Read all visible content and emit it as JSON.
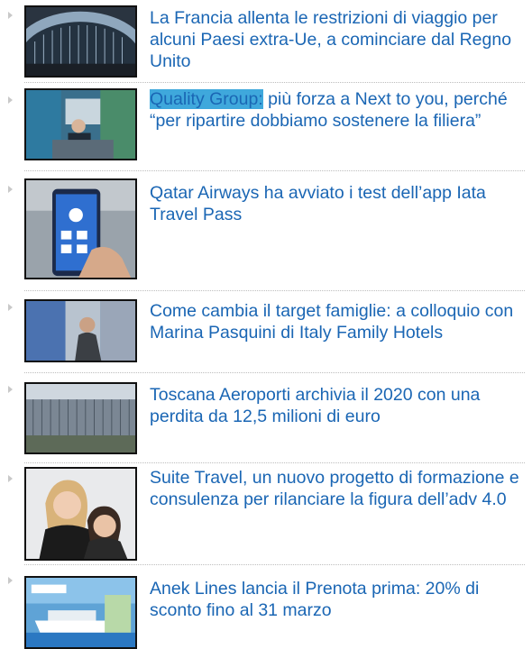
{
  "articles": [
    {
      "title": "La Francia allenta le restrizioni di viaggio per alcuni Paesi extra-Ue, a cominciare dal Regno Unito",
      "thumbnail_icon": "airport-terminal-photo"
    },
    {
      "title_highlight": "Quality Group:",
      "title_rest": " più forza a Next to you, perché “per ripartire dobbiamo sostenere la filiera”",
      "thumbnail_icon": "conference-speaker-photo"
    },
    {
      "title": "Qatar Airways ha avviato i test dell’app Iata Travel Pass",
      "thumbnail_icon": "smartphone-app-photo"
    },
    {
      "title": "Come cambia il target famiglie: a colloquio con Marina Pasquini di Italy Family Hotels",
      "thumbnail_icon": "woman-portrait-photo"
    },
    {
      "title": "Toscana Aeroporti archivia il 2020 con una perdita da 12,5 milioni di euro",
      "thumbnail_icon": "airport-building-photo"
    },
    {
      "title": "Suite Travel, un nuovo progetto di formazione e consulenza per rilanciare la figura dell’adv 4.0",
      "thumbnail_icon": "two-women-photo"
    },
    {
      "title": "Anek Lines lancia il Prenota prima: 20% di sconto fino al 31 marzo",
      "thumbnail_icon": "ferry-ship-photo"
    }
  ],
  "colors": {
    "link": "#1a66b4",
    "highlight": "#3fa8dc",
    "separator": "#bdbdbd",
    "arrow": "#c9c9c9"
  }
}
